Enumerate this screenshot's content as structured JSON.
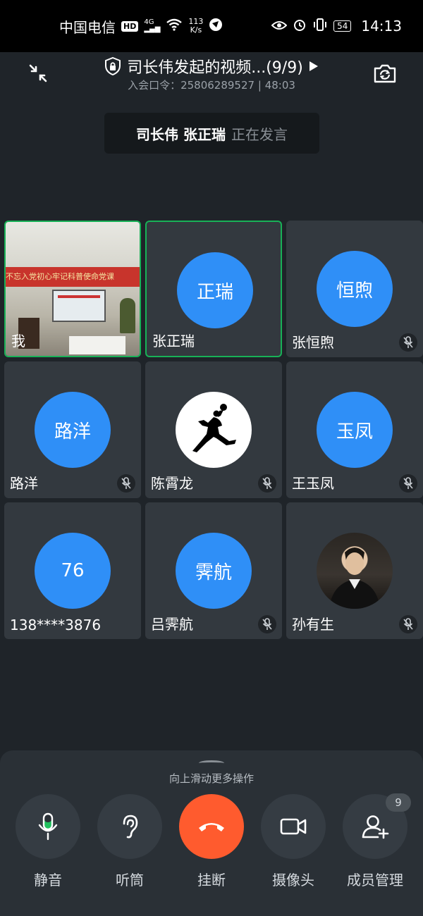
{
  "status_bar": {
    "carrier": "中国电信",
    "hd": "HD",
    "network": "4G",
    "speed_value": "113",
    "speed_unit": "K/s",
    "battery": "54",
    "time": "14:13"
  },
  "header": {
    "title": "司长伟发起的视频...(9/9)",
    "meeting_code_label": "入会口令：",
    "meeting_code": "25806289527",
    "separator": "|",
    "duration": "48:03"
  },
  "speaking": {
    "names": "司长伟 张正瑞",
    "status": "正在发言"
  },
  "participants": [
    {
      "name": "我",
      "avatar_text": "",
      "avatar_type": "video",
      "muted": false,
      "active": true
    },
    {
      "name": "张正瑞",
      "avatar_text": "正瑞",
      "avatar_type": "initials",
      "muted": false,
      "active": true
    },
    {
      "name": "张恒煦",
      "avatar_text": "恒煦",
      "avatar_type": "initials",
      "muted": true,
      "active": false
    },
    {
      "name": "路洋",
      "avatar_text": "路洋",
      "avatar_type": "initials",
      "muted": true,
      "active": false
    },
    {
      "name": "陈霄龙",
      "avatar_text": "",
      "avatar_type": "jumpman-logo",
      "muted": true,
      "active": false
    },
    {
      "name": "王玉凤",
      "avatar_text": "玉凤",
      "avatar_type": "initials",
      "muted": true,
      "active": false
    },
    {
      "name": "138****3876",
      "avatar_text": "76",
      "avatar_type": "initials",
      "muted": false,
      "active": false
    },
    {
      "name": "吕霁航",
      "avatar_text": "霁航",
      "avatar_type": "initials",
      "muted": true,
      "active": false
    },
    {
      "name": "孙有生",
      "avatar_text": "",
      "avatar_type": "photo",
      "muted": true,
      "active": false
    }
  ],
  "video_banner_text": "不忘入党初心牢记科普使命党课",
  "controls": {
    "hint": "向上滑动更多操作",
    "mute_label": "静音",
    "earpiece_label": "听筒",
    "hangup_label": "挂断",
    "camera_label": "摄像头",
    "members_label": "成员管理",
    "member_count": "9"
  },
  "colors": {
    "background": "#1f2429",
    "tile": "#33393f",
    "avatar_blue": "#2f8ff7",
    "active_border": "#18b157",
    "hangup": "#ff5b2e"
  }
}
